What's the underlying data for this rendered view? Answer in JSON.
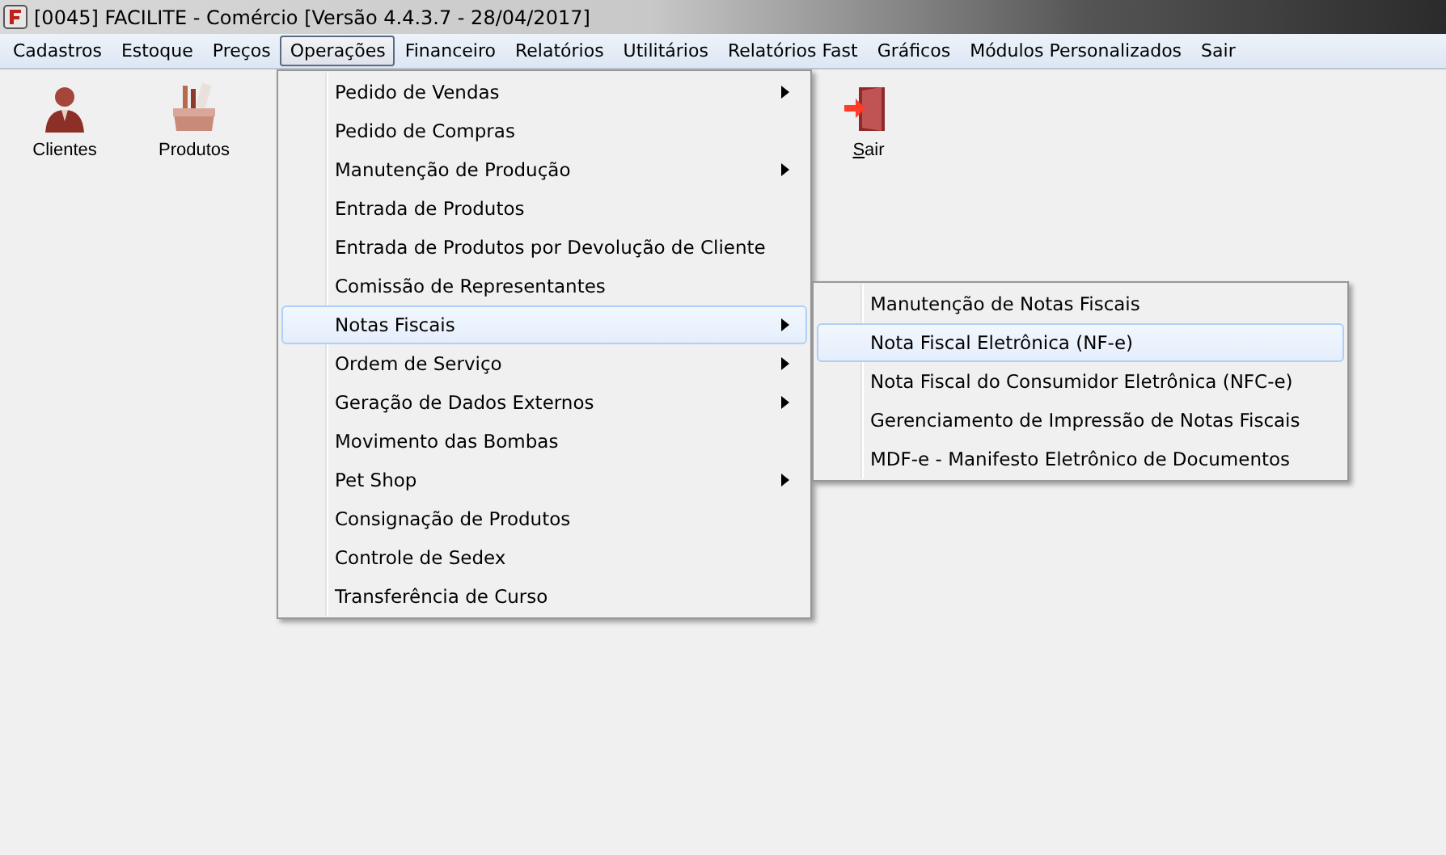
{
  "window": {
    "title": "[0045] FACILITE - Comércio [Versão 4.4.3.7 - 28/04/2017]"
  },
  "menubar": [
    {
      "label": "Cadastros",
      "selected": false
    },
    {
      "label": "Estoque",
      "selected": false
    },
    {
      "label": "Preços",
      "selected": false
    },
    {
      "label": "Operações",
      "selected": true
    },
    {
      "label": "Financeiro",
      "selected": false
    },
    {
      "label": "Relatórios",
      "selected": false
    },
    {
      "label": "Utilitários",
      "selected": false
    },
    {
      "label": "Relatórios Fast",
      "selected": false
    },
    {
      "label": "Gráficos",
      "selected": false
    },
    {
      "label": "Módulos Personalizados",
      "selected": false
    },
    {
      "label": "Sair",
      "selected": false
    }
  ],
  "toolbar": [
    {
      "label": "Clientes",
      "kind": "person"
    },
    {
      "label": "Produtos",
      "kind": "tools"
    },
    {
      "label": "Sair",
      "kind": "exit"
    }
  ],
  "menu": [
    {
      "label": "Pedido de Vendas",
      "submenu": true,
      "selected": false
    },
    {
      "label": "Pedido de Compras",
      "submenu": false,
      "selected": false
    },
    {
      "label": "Manutenção de Produção",
      "submenu": true,
      "selected": false
    },
    {
      "label": "Entrada de Produtos",
      "submenu": false,
      "selected": false
    },
    {
      "label": "Entrada de Produtos por Devolução de Cliente",
      "submenu": false,
      "selected": false
    },
    {
      "label": "Comissão de Representantes",
      "submenu": false,
      "selected": false
    },
    {
      "label": "Notas Fiscais",
      "submenu": true,
      "selected": true
    },
    {
      "label": "Ordem de Serviço",
      "submenu": true,
      "selected": false
    },
    {
      "label": "Geração de Dados Externos",
      "submenu": true,
      "selected": false
    },
    {
      "label": "Movimento das Bombas",
      "submenu": false,
      "selected": false
    },
    {
      "label": "Pet Shop",
      "submenu": true,
      "selected": false
    },
    {
      "label": "Consignação de Produtos",
      "submenu": false,
      "selected": false
    },
    {
      "label": "Controle de Sedex",
      "submenu": false,
      "selected": false
    },
    {
      "label": "Transferência de Curso",
      "submenu": false,
      "selected": false
    }
  ],
  "submenu": [
    {
      "label": "Manutenção de Notas Fiscais",
      "selected": false
    },
    {
      "label": "Nota Fiscal Eletrônica (NF-e)",
      "selected": true
    },
    {
      "label": "Nota Fiscal do Consumidor Eletrônica (NFC-e)",
      "selected": false
    },
    {
      "label": "Gerenciamento de Impressão de Notas Fiscais",
      "selected": false
    },
    {
      "label": "MDF-e - Manifesto Eletrônico de Documentos",
      "selected": false
    }
  ]
}
